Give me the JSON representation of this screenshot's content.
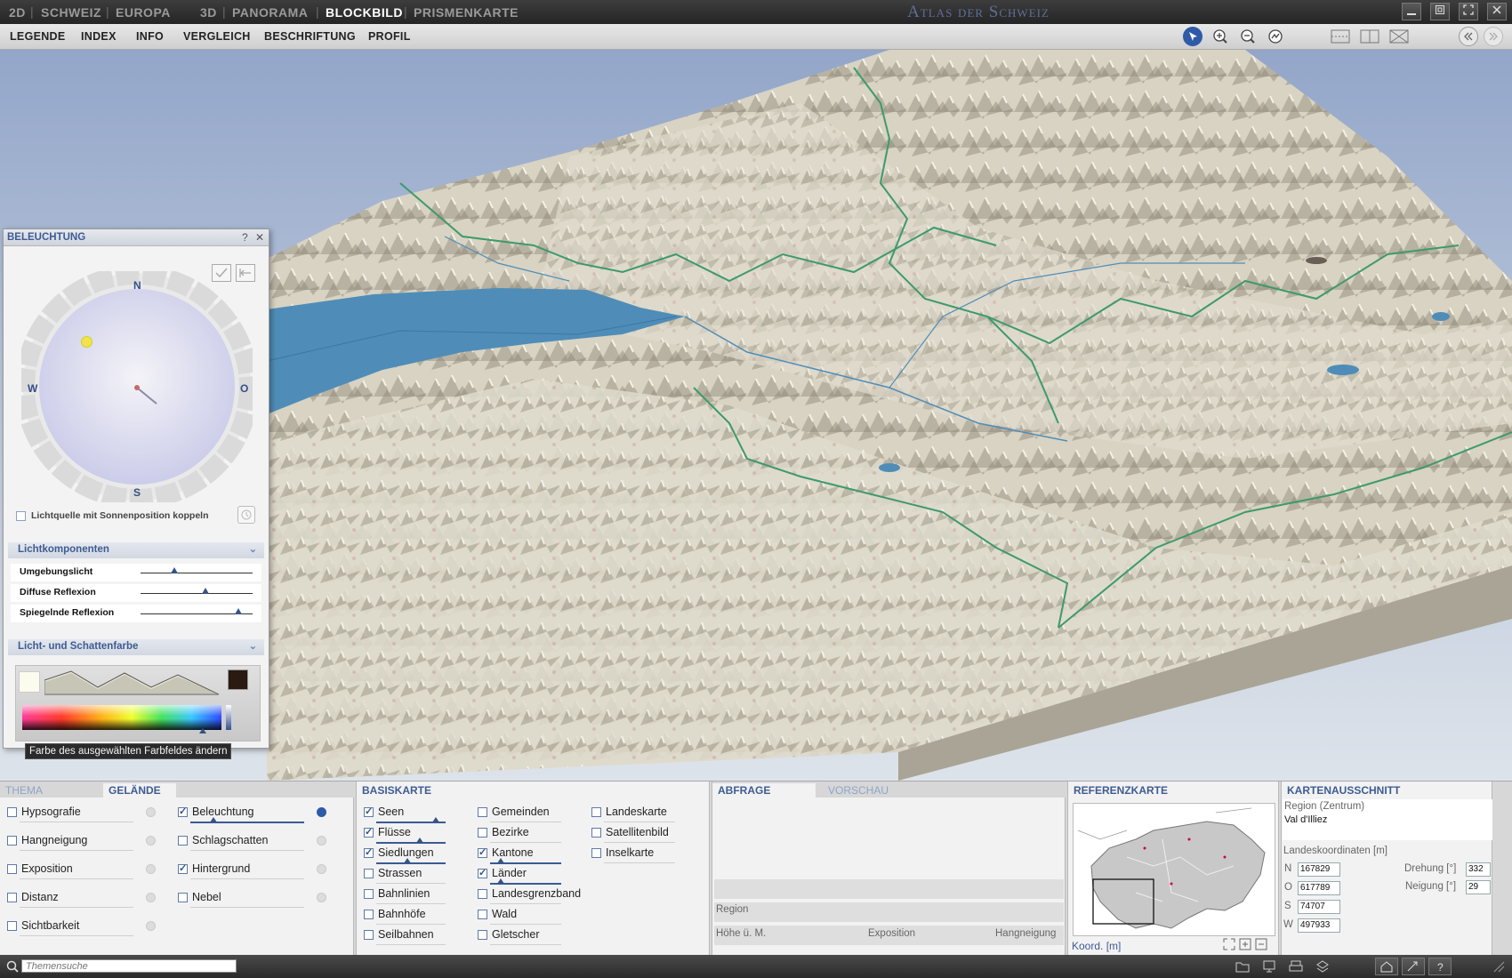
{
  "topbar": {
    "items": [
      "2D",
      "SCHWEIZ",
      "EUROPA",
      "3D",
      "PANORAMA",
      "BLOCKBILD",
      "PRISMENKARTE"
    ],
    "active": "BLOCKBILD",
    "title": "Atlas der Schweiz"
  },
  "menubar": {
    "items": [
      "LEGENDE",
      "INDEX",
      "INFO",
      "VERGLEICH",
      "BESCHRIFTUNG",
      "PROFIL"
    ]
  },
  "lighting_panel": {
    "title": "BELEUCHTUNG",
    "help": "?",
    "close": "✕",
    "compass": {
      "n": "N",
      "s": "S",
      "w": "W",
      "o": "O"
    },
    "couple_label": "Lichtquelle mit Sonnenposition koppeln",
    "section_components": "Lichtkomponenten",
    "sliders": [
      {
        "label": "Umgebungslicht",
        "value": 0.3
      },
      {
        "label": "Diffuse Reflexion",
        "value": 0.58
      },
      {
        "label": "Spiegelnde Reflexion",
        "value": 0.87
      }
    ],
    "section_colors": "Licht- und Schattenfarbe",
    "tooltip": "Farbe des ausgewählten Farbfeldes ändern"
  },
  "thema_panel": {
    "tabs": [
      "THEMA",
      "GELÄNDE"
    ],
    "active_tab": "GELÄNDE",
    "left_options": [
      {
        "label": "Hypsografie",
        "checked": false
      },
      {
        "label": "Hangneigung",
        "checked": false
      },
      {
        "label": "Exposition",
        "checked": false
      },
      {
        "label": "Distanz",
        "checked": false
      },
      {
        "label": "Sichtbarkeit",
        "checked": false
      }
    ],
    "right_options": [
      {
        "label": "Beleuchtung",
        "checked": true
      },
      {
        "label": "Schlagschatten",
        "checked": false
      },
      {
        "label": "Hintergrund",
        "checked": true
      },
      {
        "label": "Nebel",
        "checked": false
      }
    ]
  },
  "basiskarte_panel": {
    "title": "BASISKARTE",
    "col1": [
      {
        "label": "Seen",
        "checked": true
      },
      {
        "label": "Flüsse",
        "checked": true
      },
      {
        "label": "Siedlungen",
        "checked": true
      },
      {
        "label": "Strassen",
        "checked": false
      },
      {
        "label": "Bahnlinien",
        "checked": false
      },
      {
        "label": "Bahnhöfe",
        "checked": false
      },
      {
        "label": "Seilbahnen",
        "checked": false
      }
    ],
    "col2": [
      {
        "label": "Gemeinden",
        "checked": false
      },
      {
        "label": "Bezirke",
        "checked": false
      },
      {
        "label": "Kantone",
        "checked": true
      },
      {
        "label": "Länder",
        "checked": true
      },
      {
        "label": "Landesgrenzband",
        "checked": false
      },
      {
        "label": "Wald",
        "checked": false
      },
      {
        "label": "Gletscher",
        "checked": false
      }
    ],
    "col3": [
      {
        "label": "Landeskarte",
        "checked": false
      },
      {
        "label": "Satellitenbild",
        "checked": false
      },
      {
        "label": "Inselkarte",
        "checked": false
      }
    ]
  },
  "abfrage_panel": {
    "tabs": [
      "ABFRAGE",
      "VORSCHAU"
    ],
    "region_label": "Region",
    "hoehe_label": "Höhe ü. M.",
    "exposition_label": "Exposition",
    "hangneigung_label": "Hangneigung"
  },
  "referenz_panel": {
    "title": "REFERENZKARTE",
    "coord_label": "Koord. [m]"
  },
  "kartenausschnitt_panel": {
    "title": "KARTENAUSSCHNITT",
    "region_label": "Region (Zentrum)",
    "region_value": "Val d'Illiez",
    "coords_label": "Landeskoordinaten [m]",
    "n_label": "N",
    "n_value": "167829",
    "o_label": "O",
    "o_value": "617789",
    "s_label": "S",
    "s_value": "74707",
    "w_label": "W",
    "w_value": "497933",
    "drehung_label": "Drehung [°]",
    "drehung_value": "332",
    "neigung_label": "Neigung [°]",
    "neigung_value": "29"
  },
  "statusbar": {
    "search_placeholder": "Themensuche"
  }
}
